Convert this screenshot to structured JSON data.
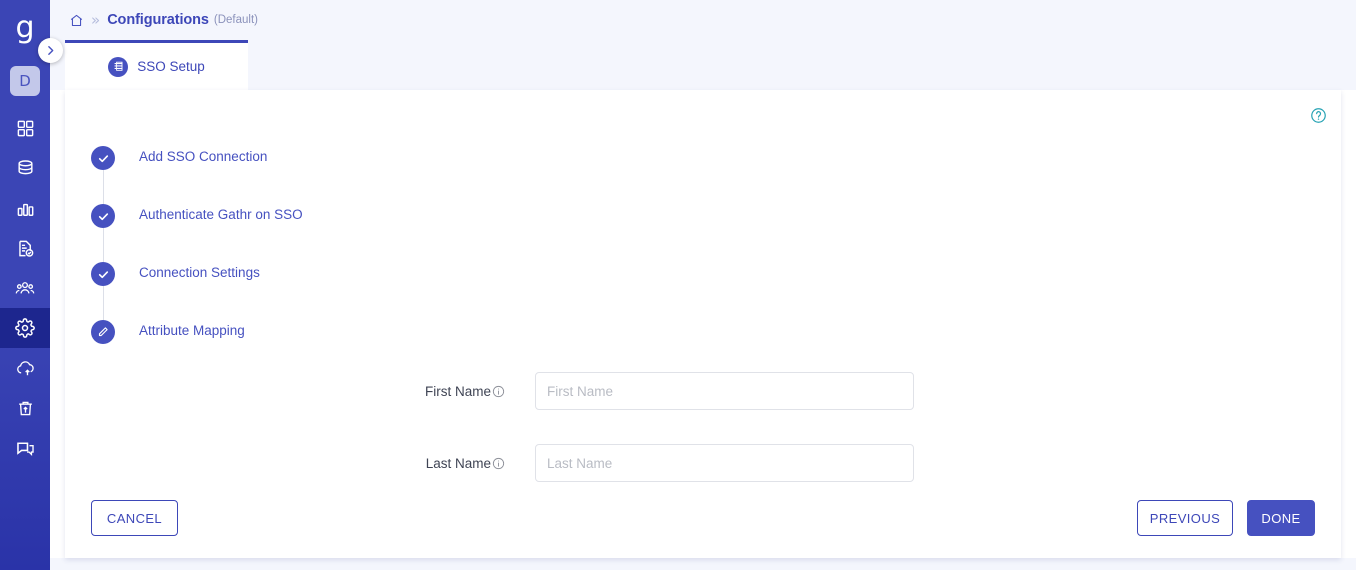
{
  "app": {
    "logo_letter": "g",
    "account_initial": "D"
  },
  "sidebar": {
    "items": [
      {
        "icon": "dashboard-grid-icon",
        "name": "dashboard",
        "active": false
      },
      {
        "icon": "database-icon",
        "name": "data",
        "active": false
      },
      {
        "icon": "bar-chart-icon",
        "name": "analytics",
        "active": false
      },
      {
        "icon": "document-check-icon",
        "name": "reports",
        "active": false
      },
      {
        "icon": "users-group-icon",
        "name": "users",
        "active": false
      },
      {
        "icon": "gear-icon",
        "name": "settings",
        "active": true
      },
      {
        "icon": "cloud-upload-icon",
        "name": "deploy",
        "active": false
      },
      {
        "icon": "trash-upload-icon",
        "name": "recycle-bin",
        "active": false
      },
      {
        "icon": "chat-icon",
        "name": "support",
        "active": false
      }
    ],
    "expand_toggle": "chevron-right-icon"
  },
  "breadcrumb": {
    "home_icon": "home-icon",
    "separator": "»",
    "title": "Configurations",
    "subtitle": "(Default)"
  },
  "tabs": [
    {
      "label": "SSO Setup",
      "icon": "sso-stack-icon",
      "active": true
    }
  ],
  "panel": {
    "help_icon": "help-circle-icon"
  },
  "stepper": {
    "steps": [
      {
        "label": "Add SSO Connection",
        "state": "complete",
        "icon": "check-icon"
      },
      {
        "label": "Authenticate Gathr on SSO",
        "state": "complete",
        "icon": "check-icon"
      },
      {
        "label": "Connection Settings",
        "state": "complete",
        "icon": "check-icon"
      },
      {
        "label": "Attribute Mapping",
        "state": "current",
        "icon": "pencil-icon"
      }
    ]
  },
  "form": {
    "fields": [
      {
        "label": "First Name",
        "info_icon": "info-icon",
        "value": "",
        "placeholder": "First Name"
      },
      {
        "label": "Last Name",
        "info_icon": "info-icon",
        "value": "",
        "placeholder": "Last Name"
      }
    ]
  },
  "footer": {
    "cancel_label": "CANCEL",
    "previous_label": "PREVIOUS",
    "done_label": "DONE"
  },
  "colors": {
    "sidebar_bg": "#3b45b5",
    "sidebar_active": "#1d268e",
    "primary": "#4651c0",
    "primary_text": "#3d47b8",
    "page_bg": "#f4f6fd",
    "help_accent": "#27a3b4",
    "input_border": "#e0e2e8",
    "placeholder": "#b9bcc4"
  }
}
